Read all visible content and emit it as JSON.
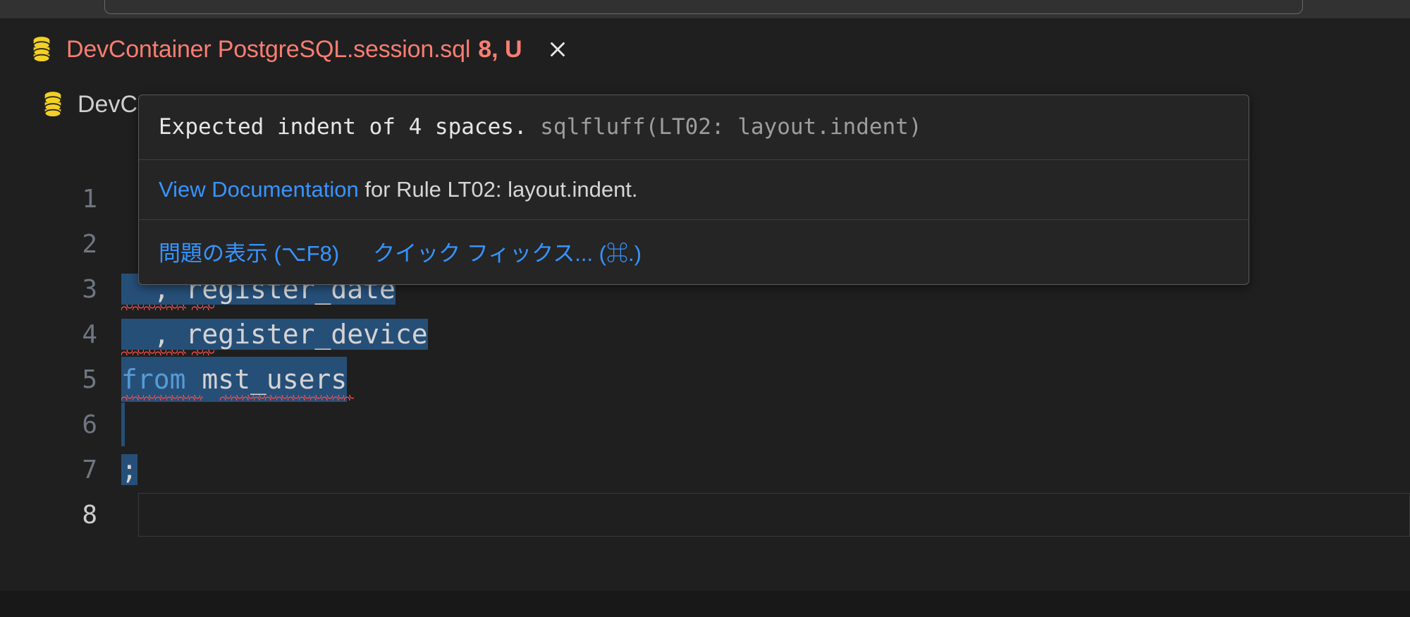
{
  "window": {
    "background": "#1f1f1f",
    "editor_background": "#1f1f1f"
  },
  "quick_input": {
    "value": "",
    "placeholder": ""
  },
  "breadcrumb": {
    "icon": "database-icon",
    "label": "DevContainer PostgreSQL.session.sql",
    "position": "8, U",
    "color": "#f97d72",
    "close_icon": "close-icon"
  },
  "breadcrumb_behind": {
    "icon": "database-icon",
    "label": "DevC"
  },
  "hover": {
    "message": "Expected indent of 4 spaces.",
    "source": "sqlfluff(LT02: layout.indent)",
    "docs_link": "View Documentation",
    "docs_rest": " for Rule LT02: layout.indent.",
    "actions": [
      {
        "label": "問題の表示 (⌥F8)",
        "name": "show-problem-action"
      },
      {
        "label": "クイック フィックス... (⌘.)",
        "name": "quick-fix-action"
      }
    ],
    "link_color": "#3794ff",
    "background": "#252526",
    "border": "#5a5a5a"
  },
  "editor": {
    "selection_color": "#264f78",
    "squiggle_color": "#f14c4c",
    "keyword_color": "#569cd6",
    "text_color": "#d4d4d4",
    "line_number_color": "#6e7681",
    "lines": [
      {
        "number": "1",
        "text": "",
        "indent": 0,
        "selected": false,
        "squiggle": false
      },
      {
        "number": "2",
        "text": "",
        "indent": 0,
        "selected": false,
        "squiggle": false
      },
      {
        "number": "3",
        "text": "  , register_date",
        "indent": 0,
        "selected": true,
        "squiggle": true
      },
      {
        "number": "4",
        "text": "  , register_device",
        "indent": 0,
        "selected": true,
        "squiggle": true
      },
      {
        "number": "5",
        "text": "from mst_users",
        "keyword": "from",
        "rest": " mst_users",
        "indent": 0,
        "selected": true,
        "squiggle": true
      },
      {
        "number": "6",
        "text": "",
        "indent": 0,
        "selected": true,
        "squiggle": false
      },
      {
        "number": "7",
        "text": ";",
        "indent": 0,
        "selected": true,
        "squiggle": false
      },
      {
        "number": "8",
        "text": "",
        "indent": 0,
        "selected": false,
        "squiggle": false,
        "cursor": true
      }
    ]
  }
}
